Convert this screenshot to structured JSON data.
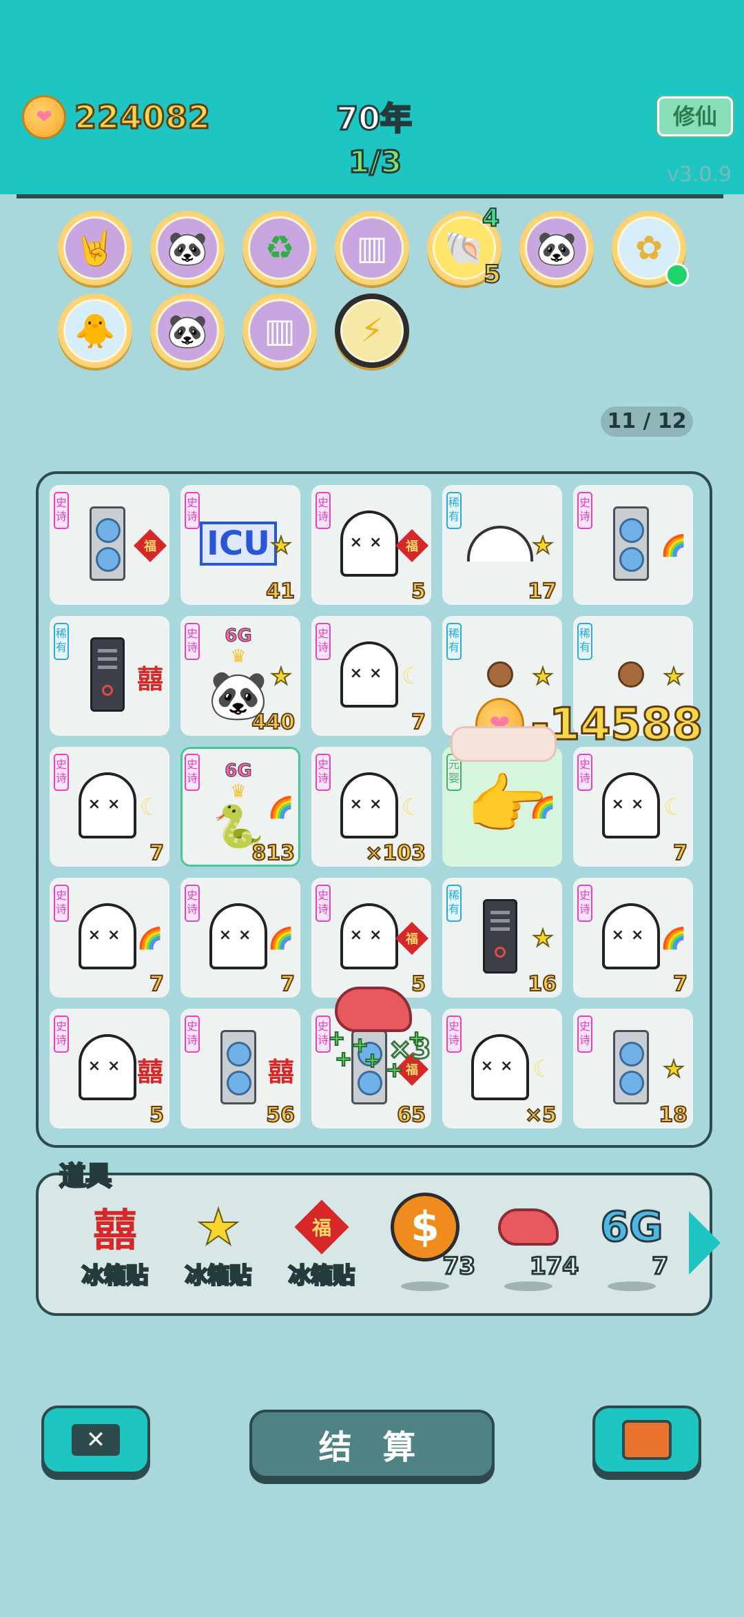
{
  "header": {
    "coins": "224082",
    "year": "70年",
    "round": "1/3",
    "cultivate_button": "修仙",
    "version": "v3.0.9"
  },
  "relics": [
    {
      "name": "rock-hand",
      "glyph": "🤘"
    },
    {
      "name": "panda",
      "glyph": "🐼"
    },
    {
      "name": "recycle",
      "glyph": "♻"
    },
    {
      "name": "pleated-skirt",
      "glyph": "▥"
    },
    {
      "name": "shell",
      "glyph": "🐚",
      "top_count": "4",
      "bottom_count": "5"
    },
    {
      "name": "panda",
      "glyph": "🐼"
    },
    {
      "name": "potted-flower",
      "glyph": "✿"
    },
    {
      "name": "rice-cooker-duck",
      "glyph": "🐥"
    },
    {
      "name": "panda",
      "glyph": "🐼"
    },
    {
      "name": "pleated-skirt",
      "glyph": "▥"
    },
    {
      "name": "lightning",
      "glyph": "⚡"
    }
  ],
  "page_indicator": "11 / 12",
  "rarity_labels": {
    "epic": "史诗",
    "rare": "稀有",
    "nascent": "元婴"
  },
  "board": {
    "cells": [
      {
        "tag": "史诗",
        "main": "gpu",
        "side": "福",
        "count": ""
      },
      {
        "tag": "史诗",
        "main": "ICU",
        "side": "star",
        "count": "41"
      },
      {
        "tag": "史诗",
        "main": "ghost",
        "side": "福",
        "count": "5"
      },
      {
        "tag": "稀有",
        "main": "gauge",
        "side": "star",
        "count": "17"
      },
      {
        "tag": "史诗",
        "main": "gpu",
        "side": "rainbow",
        "count": ""
      },
      {
        "tag": "稀有",
        "main": "server",
        "side": "囍",
        "count": ""
      },
      {
        "tag": "史诗",
        "main": "panda-6g",
        "side": "star",
        "count": "440"
      },
      {
        "tag": "史诗",
        "main": "ghost",
        "side": "moon",
        "count": "7"
      },
      {
        "tag": "稀有",
        "main": "nut",
        "side": "star",
        "count": ""
      },
      {
        "tag": "稀有",
        "main": "nut",
        "side": "star",
        "count": ""
      },
      {
        "tag": "史诗",
        "main": "ghost",
        "side": "moon",
        "count": "7"
      },
      {
        "tag": "史诗",
        "main": "snake-6g",
        "side": "rainbow",
        "count": "813"
      },
      {
        "tag": "史诗",
        "main": "ghost",
        "side": "moon",
        "count": "×103"
      },
      {
        "tag": "元婴",
        "main": "hand",
        "side": "rainbow",
        "count": ""
      },
      {
        "tag": "史诗",
        "main": "ghost",
        "side": "moon",
        "count": "7"
      },
      {
        "tag": "史诗",
        "main": "ghost",
        "side": "rainbow",
        "count": "7"
      },
      {
        "tag": "史诗",
        "main": "ghost",
        "side": "rainbow",
        "count": "7"
      },
      {
        "tag": "史诗",
        "main": "ghost",
        "side": "福",
        "count": "5"
      },
      {
        "tag": "稀有",
        "main": "server",
        "side": "star",
        "count": "16"
      },
      {
        "tag": "史诗",
        "main": "ghost",
        "side": "rainbow",
        "count": "7"
      },
      {
        "tag": "史诗",
        "main": "ghost",
        "side": "囍",
        "count": "5"
      },
      {
        "tag": "史诗",
        "main": "gpu",
        "side": "囍",
        "count": "56"
      },
      {
        "tag": "史诗",
        "main": "gpu",
        "side": "福",
        "count": "65"
      },
      {
        "tag": "史诗",
        "main": "ghost",
        "side": "moon",
        "count": "×5"
      },
      {
        "tag": "史诗",
        "main": "gpu",
        "side": "star",
        "count": "18"
      }
    ]
  },
  "effects": {
    "score_popup": "-14588",
    "multiplier": "×3",
    "six_g": "6G"
  },
  "props": {
    "title": "道具",
    "items": [
      {
        "icon": "囍",
        "label": "冰箱贴",
        "count": ""
      },
      {
        "icon": "star",
        "label": "冰箱贴",
        "count": ""
      },
      {
        "icon": "福",
        "label": "冰箱贴",
        "count": ""
      },
      {
        "icon": "$",
        "label": "",
        "count": "73"
      },
      {
        "icon": "liver",
        "label": "",
        "count": "174"
      },
      {
        "icon": "6G",
        "label": "",
        "count": "7"
      }
    ]
  },
  "buttons": {
    "settle": "结 算"
  },
  "colors": {
    "header": "#1dc6c3",
    "background": "#a9d8dc",
    "border": "#2d4b4c",
    "coin_text": "#f7d64a"
  }
}
